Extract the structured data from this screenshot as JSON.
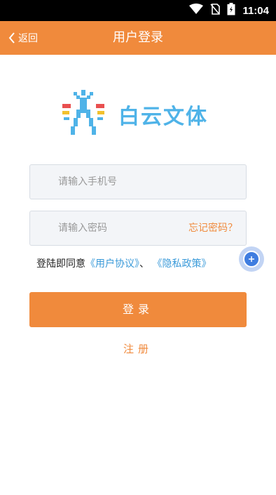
{
  "status_bar": {
    "time": "11:04"
  },
  "header": {
    "back_label": "返回",
    "title": "用户登录"
  },
  "brand": {
    "name": "白云文体",
    "accent_color": "#4fb3e8"
  },
  "form": {
    "phone_placeholder": "请输入手机号",
    "password_placeholder": "请输入密码",
    "forgot_label": "忘记密码？"
  },
  "agreement": {
    "prefix": "登陆即同意",
    "user_agreement": "《用户协议》",
    "separator": "、",
    "privacy_policy": "《隐私政策》"
  },
  "actions": {
    "login_label": "登录",
    "register_label": "注册"
  },
  "colors": {
    "primary": "#f08a3c",
    "link": "#3a9ad9"
  }
}
